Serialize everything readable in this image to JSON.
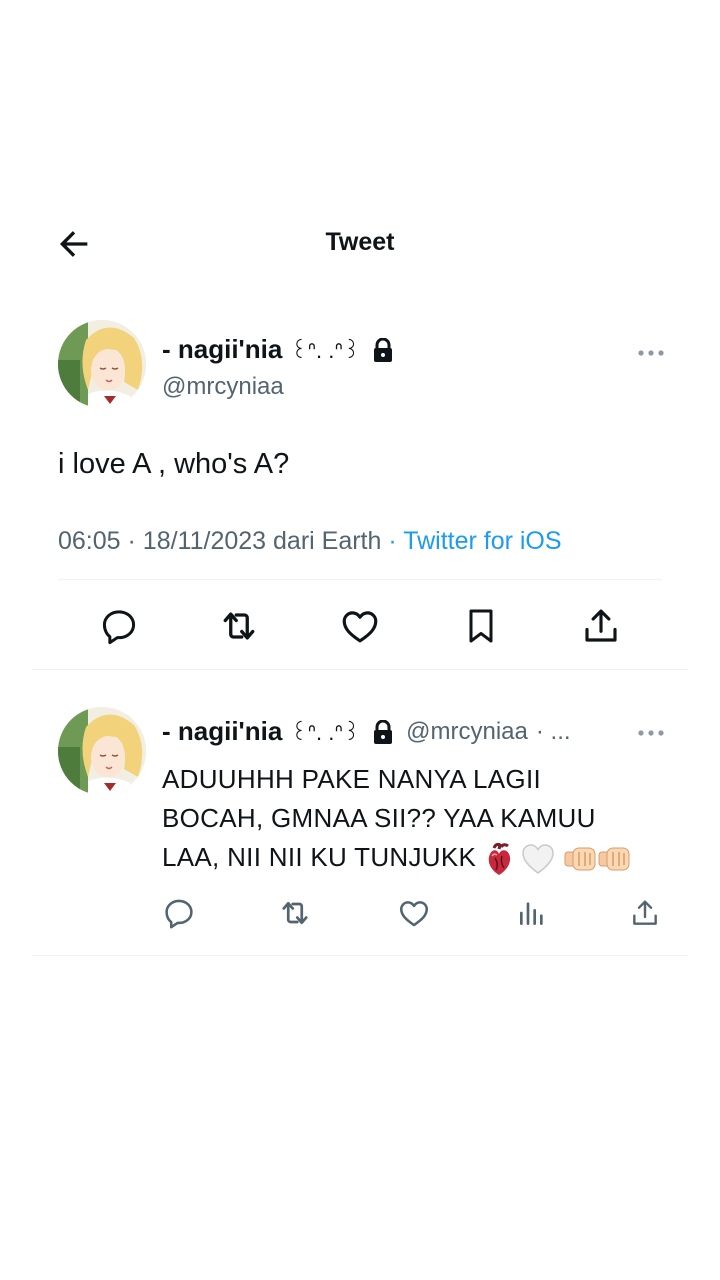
{
  "header": {
    "title": "Tweet"
  },
  "main_tweet": {
    "display_name": "- nagii'nia",
    "kaomoji": "꒰ᐢ. .ᐢ꒱",
    "handle": "@mrcyniaa",
    "text": "i love A , who's A?",
    "time": "06:05",
    "date": "18/11/2023 dari Earth",
    "source": "Twitter for iOS"
  },
  "reply": {
    "display_name": "- nagii'nia",
    "kaomoji": "꒰ᐢ. .ᐢ꒱",
    "handle": "@mrcyniaa",
    "ellipsis": "· ...",
    "text_line1": "ADUUHHH PAKE NANYA LAGII",
    "text_line2": "BOCAH, GMNAA SII?? YAA KAMUU",
    "text_line3": "LAA, NII NII KU TUNJUKK",
    "emojis": [
      "anatomical-heart",
      "white-heart",
      "fist-bump",
      "fist-bump"
    ]
  },
  "icons": [
    "back-arrow-icon",
    "lock-icon",
    "more-icon",
    "reply-icon",
    "retweet-icon",
    "like-icon",
    "bookmark-icon",
    "share-icon",
    "views-icon"
  ],
  "colors": {
    "link": "#1d9bf0",
    "secondary": "#536471",
    "primary": "#0f1419",
    "divider": "#eff3f4"
  }
}
